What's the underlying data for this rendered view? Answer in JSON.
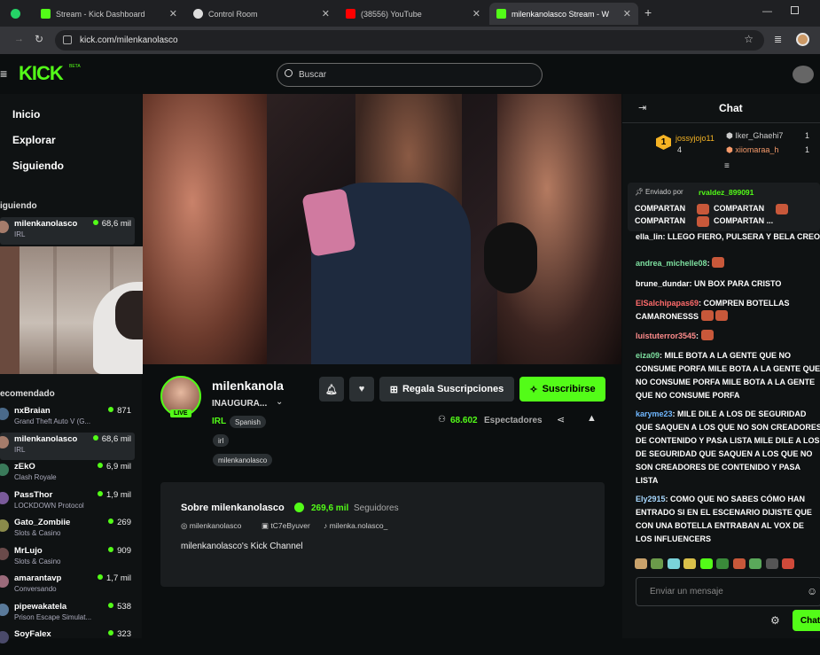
{
  "browser": {
    "tabs": [
      {
        "title": "",
        "icon": "whatsapp-icon"
      },
      {
        "title": "Stream - Kick Dashboard",
        "icon": "kick-icon"
      },
      {
        "title": "Control Room",
        "icon": "control-icon"
      },
      {
        "title": "(38556) YouTube",
        "icon": "youtube-icon"
      },
      {
        "title": "milenkanolasco Stream - W",
        "icon": "kick-icon"
      }
    ],
    "url": "kick.com/milenkanolasco"
  },
  "header": {
    "logo": "KICK",
    "logo_badge": "BETA",
    "search_placeholder": "Buscar"
  },
  "sidebar": {
    "nav": [
      "Inicio",
      "Explorar",
      "Siguiendo"
    ],
    "following_title": "iguiendo",
    "following": [
      {
        "name": "milenkanolasco",
        "category": "IRL",
        "viewers": "68,6 mil"
      }
    ],
    "recommended_title": "ecomendado",
    "recommended": [
      {
        "name": "nxBraian",
        "category": "Grand Theft Auto V (G...",
        "viewers": "871"
      },
      {
        "name": "milenkanolasco",
        "category": "IRL",
        "viewers": "68,6 mil"
      },
      {
        "name": "zEkO",
        "category": "Clash Royale",
        "viewers": "6,9 mil"
      },
      {
        "name": "PassThor",
        "category": "LOCKDOWN Protocol",
        "viewers": "1,9 mil"
      },
      {
        "name": "Gato_Zombiie",
        "category": "Slots & Casino",
        "viewers": "269"
      },
      {
        "name": "MrLujo",
        "category": "Slots & Casino",
        "viewers": "909"
      },
      {
        "name": "amarantavp",
        "category": "Conversando",
        "viewers": "1,7 mil"
      },
      {
        "name": "pipewakatela",
        "category": "Prison Escape Simulat...",
        "viewers": "538"
      },
      {
        "name": "SoyFalex",
        "category": "",
        "viewers": "323"
      }
    ]
  },
  "stream": {
    "live_badge": "LIVE",
    "channel": "milenkanola",
    "title": "INAUGURA...",
    "category": "IRL",
    "language": "Spanish",
    "tags": [
      "irl",
      "milenkanolasco"
    ],
    "gift_label": "Regala Suscripciones",
    "subscribe_label": "Suscribirse",
    "viewers": "68.602",
    "viewers_label": "Espectadores"
  },
  "about": {
    "title": "Sobre milenkanolasco",
    "followers": "269,6 mil",
    "followers_label": "Seguidores",
    "socials": [
      "milenkanolasco",
      "tC7eByuver",
      "milenka.nolasco_"
    ],
    "bio": "milenkanolasco's Kick Channel"
  },
  "chat": {
    "title": "Chat",
    "leaders": [
      {
        "rank": "1",
        "name": "jossyjojo11",
        "count": "4"
      },
      {
        "name": "Iker_Ghaehi7",
        "count": "1"
      },
      {
        "name": "xiiomaraa_h",
        "count": "1"
      }
    ],
    "pinned_by_label": "Enviado por",
    "pinned_by": "rvaldez_899091",
    "pinned_lines": [
      "COMPARTAN",
      "COMPARTAN",
      "COMPARTAN",
      "COMPARTAN ..."
    ],
    "partial_top": "ella_lin: LLEGO FIERO, PULSERA Y BELA CREO",
    "messages": [
      {
        "user": "andrea_michelle08",
        "color": "#7ee0a0",
        "text": ""
      },
      {
        "user": "brune_dundar",
        "color": "#ffffff",
        "text": "UN BOX PARA CRISTO"
      },
      {
        "user": "ElSalchipapas69",
        "color": "#ff6b6b",
        "text": "COMPREN BOTELLAS CAMARONESSS"
      },
      {
        "user": "luistuterror3545",
        "color": "#ff8c8c",
        "text": ""
      },
      {
        "user": "eiza09",
        "color": "#7ee0a0",
        "text": "MILE BOTA A LA GENTE QUE NO CONSUME PORFA MILE BOTA A LA GENTE QUE NO CONSUME PORFA MILE BOTA A LA GENTE QUE NO CONSUME PORFA"
      },
      {
        "user": "karyme23",
        "color": "#6fb7ff",
        "text": "MILE DILE A LOS DE SEGURIDAD QUE SAQUEN A LOS QUE NO SON CREADORES DE CONTENIDO Y PASA LISTA MILE DILE A LOS DE SEGURIDAD QUE SAQUEN A LOS QUE NO SON CREADORES DE CONTENIDO Y PASA LISTA"
      },
      {
        "user": "Ely2915",
        "color": "#a7d8ff",
        "text": "COMO QUE NO SABES CÓMO HAN ENTRADO SI EN EL ESCENARIO DIJISTE QUE CON UNA BOTELLA ENTRABAN AL VOX DE LOS INFLUENCERS"
      }
    ],
    "input_placeholder": "Enviar un mensaje",
    "send_label": "Chat"
  },
  "colors": {
    "kick_green": "#53fc18",
    "bg": "#0b0e0f",
    "panel": "#0f1213"
  }
}
